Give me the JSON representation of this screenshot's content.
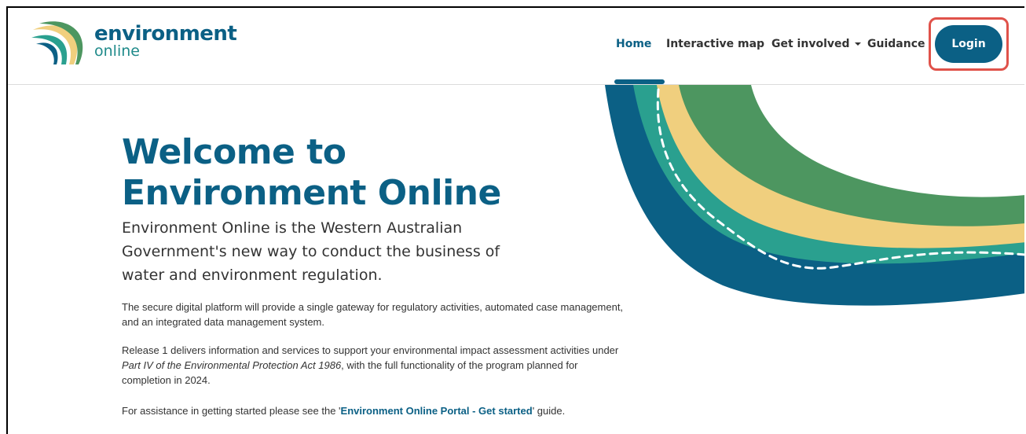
{
  "logo": {
    "name_main": "environment",
    "name_sub": "online"
  },
  "nav": {
    "home": "Home",
    "interactive_map": "Interactive map",
    "get_involved": "Get involved",
    "guidance": "Guidance",
    "login": "Login"
  },
  "hero": {
    "title_line1": "Welcome to",
    "title_line2": "Environment Online",
    "lead": "Environment Online is the Western Australian Government's new way to conduct the business of water and environment regulation.",
    "para1": "The secure digital platform will provide a single gateway for regulatory activities, automated case management, and an integrated data management system.",
    "para2_before": "Release 1 delivers information and services to support your environmental impact assessment activities under ",
    "para2_italic": "Part IV of the Environmental Protection Act 1986",
    "para2_after": ", with the full functionality of the program planned for completion in 2024.",
    "para3_before": "For assistance in getting started please see the '",
    "para3_link": "Environment Online Portal - Get started",
    "para3_after": "' guide."
  },
  "colors": {
    "brand_blue": "#0b6085",
    "teal": "#2aa08f",
    "sand": "#f0cf7e",
    "green": "#4d9660",
    "highlight": "#e0524a"
  },
  "icons": {
    "logo": "environment-online-logo-icon",
    "dropdown": "chevron-down-icon"
  }
}
